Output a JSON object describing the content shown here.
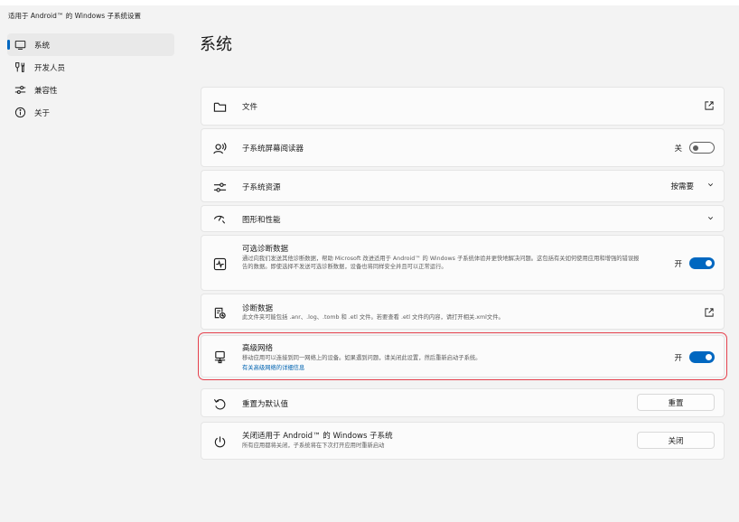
{
  "app": {
    "title": "适用于 Android™ 的 Windows 子系统设置"
  },
  "sidebar": {
    "items": [
      {
        "label": "系统",
        "icon": "monitor-icon",
        "active": true
      },
      {
        "label": "开发人员",
        "icon": "developer-tools-icon"
      },
      {
        "label": "兼容性",
        "icon": "sliders-icon"
      },
      {
        "label": "关于",
        "icon": "info-icon"
      }
    ]
  },
  "page": {
    "title": "系统"
  },
  "settings": {
    "files": {
      "title": "文件",
      "icon": "folder-icon",
      "action_icon": "open-external-icon"
    },
    "screen_reader": {
      "title": "子系统屏幕阅读器",
      "icon": "screen-reader-icon",
      "state": "关"
    },
    "resources": {
      "title": "子系统资源",
      "icon": "sliders-icon",
      "value": "按需要",
      "action_icon": "chevron-down-icon"
    },
    "graphics": {
      "title": "图形和性能",
      "icon": "gauge-icon",
      "action_icon": "chevron-down-icon"
    },
    "optional_diagnostics": {
      "title": "可选诊断数据",
      "icon": "activity-icon",
      "desc": "通过向我们发送其他诊断数据，帮助 Microsoft 改进适用于 Android™ 的 Windows 子系统体验并更快地解决问题。这包括有关如何使用应用和增强的错误报告的数据。即使选择不发送可选诊断数据，设备也将同样安全并且可以正常运行。",
      "state": "开"
    },
    "diagnostic_data": {
      "title": "诊断数据",
      "icon": "diagnostic-file-icon",
      "desc": "此文件夹可能包括 .anr、.log、.tomb 和 .etl 文件。若要查看 .etl 文件的内容，请打开相关.xml文件。",
      "action_icon": "open-external-icon"
    },
    "advanced_networking": {
      "title": "高级网络",
      "icon": "network-icon",
      "desc": "移动应用可以连接到同一网络上的设备。如果遇到问题，请关闭此设置，然后重新启动子系统。",
      "link": "有关高级网络的详细信息",
      "state": "开"
    },
    "reset": {
      "title": "重置为默认值",
      "icon": "reset-icon",
      "button": "重置"
    },
    "shutdown": {
      "title": "关闭适用于 Android™ 的 Windows 子系统",
      "icon": "power-icon",
      "desc": "所有应用都将关闭，子系统将在下次打开应用时重新启动",
      "button": "关闭"
    }
  },
  "colors": {
    "accent": "#0067c0",
    "highlight_border": "#e6414d",
    "background": "#f3f3f3",
    "card": "#fbfbfb"
  }
}
